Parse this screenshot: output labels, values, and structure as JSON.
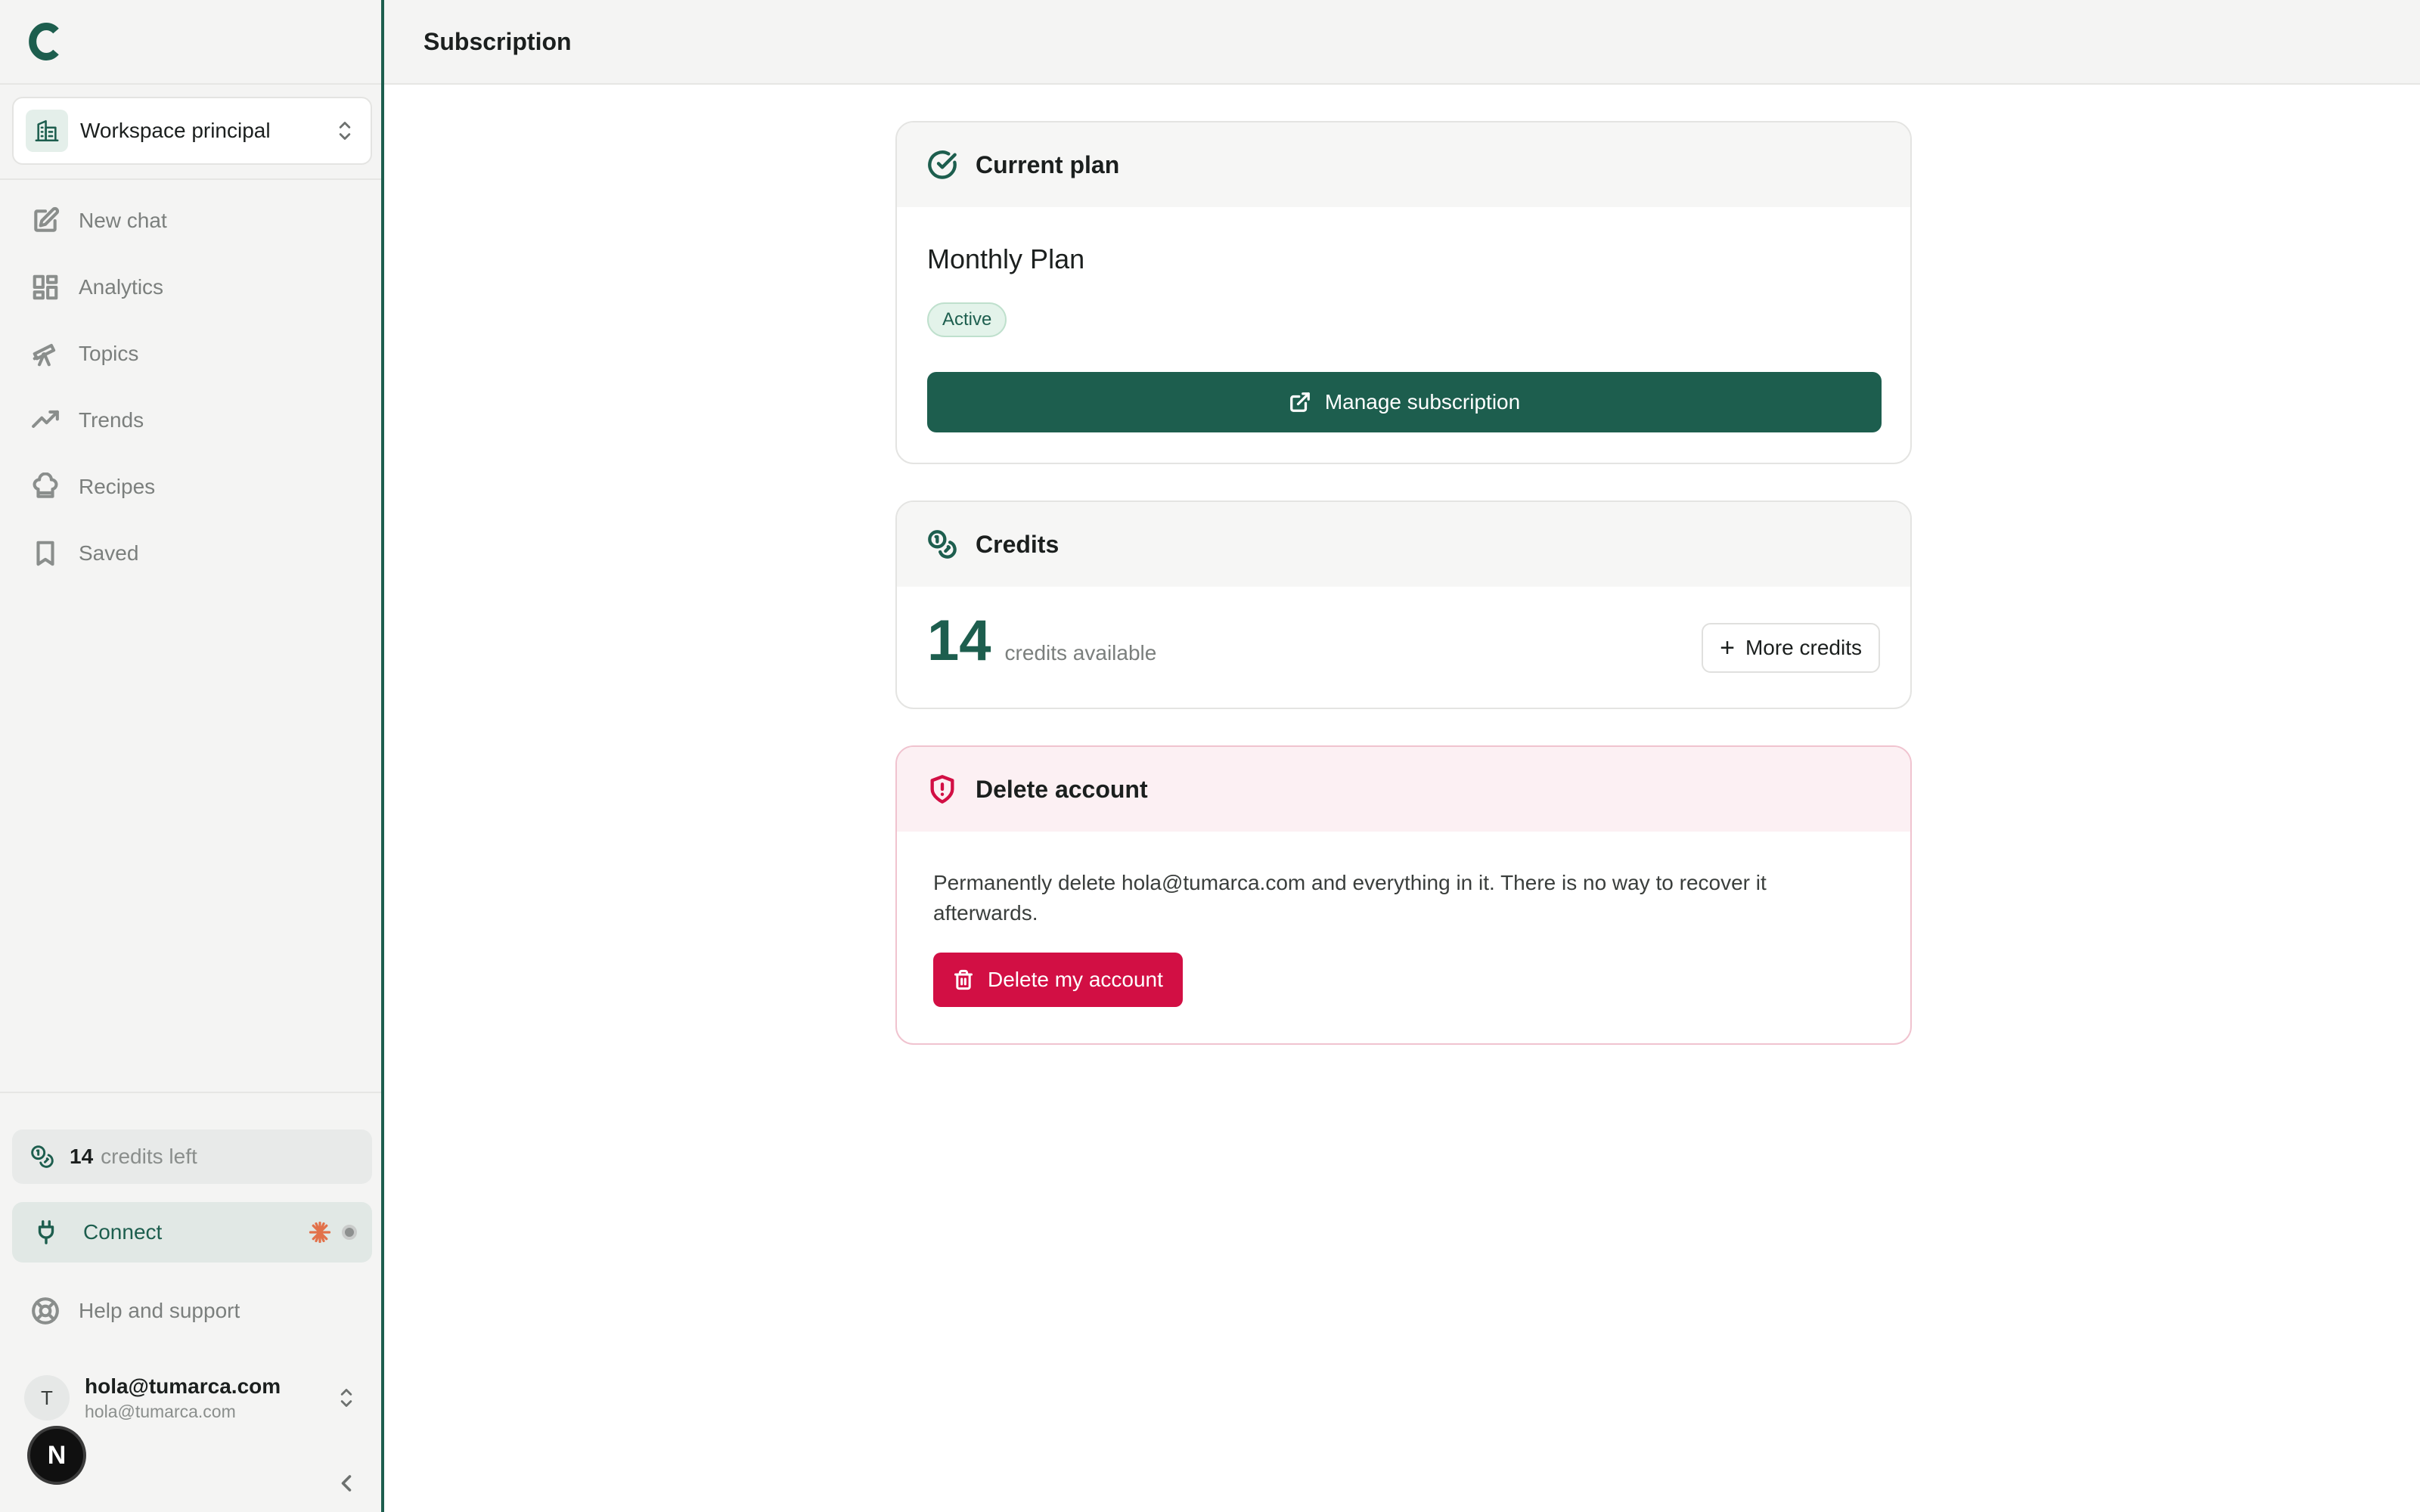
{
  "sidebar": {
    "logo_icon": "brand-c-icon",
    "workspace": {
      "label": "Workspace principal",
      "icon": "building-icon"
    },
    "nav": [
      {
        "label": "New chat",
        "icon": "edit-icon"
      },
      {
        "label": "Analytics",
        "icon": "grid-icon"
      },
      {
        "label": "Topics",
        "icon": "telescope-icon"
      },
      {
        "label": "Trends",
        "icon": "trending-up-icon"
      },
      {
        "label": "Recipes",
        "icon": "chef-hat-icon"
      },
      {
        "label": "Saved",
        "icon": "bookmark-icon"
      }
    ],
    "credits": {
      "count": "14",
      "suffix": "credits left"
    },
    "connect": {
      "label": "Connect"
    },
    "help": {
      "label": "Help and support"
    },
    "user": {
      "initial": "T",
      "name": "hola@tumarca.com",
      "email": "hola@tumarca.com"
    },
    "badge_letter": "N"
  },
  "header": {
    "title": "Subscription"
  },
  "plan": {
    "heading": "Current plan",
    "name": "Monthly Plan",
    "status": "Active",
    "manage_label": "Manage subscription"
  },
  "credits": {
    "heading": "Credits",
    "count": "14",
    "caption": "credits available",
    "more_label": "More credits"
  },
  "delete": {
    "heading": "Delete account",
    "description": "Permanently delete hola@tumarca.com and everything in it. There is no way to recover it afterwards.",
    "button_label": "Delete my account"
  },
  "colors": {
    "brand": "#1d5e4e",
    "danger": "#d20f44",
    "sidebar_bg": "#f4f4f3"
  }
}
